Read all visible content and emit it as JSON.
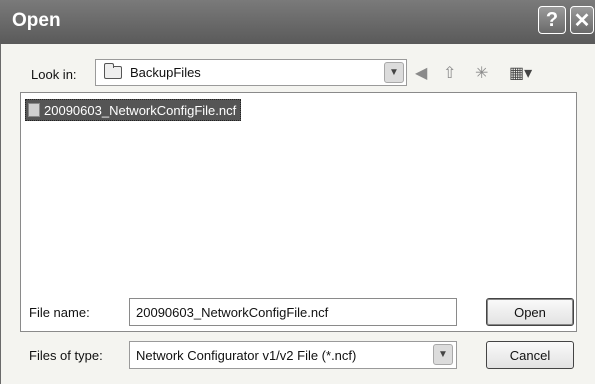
{
  "window": {
    "title": "Open",
    "help_glyph": "?",
    "close_glyph": "✕"
  },
  "lookin": {
    "label": "Look in:",
    "value": "BackupFiles",
    "toolbar_icons": [
      "back-icon",
      "up-folder-icon",
      "new-folder-icon",
      "views-menu-icon"
    ]
  },
  "files": [
    {
      "name": "20090603_NetworkConfigFile.ncf",
      "selected": true
    }
  ],
  "filename": {
    "label": "File name:",
    "value": "20090603_NetworkConfigFile.ncf"
  },
  "filetype": {
    "label": "Files of type:",
    "value": "Network Configurator v1/v2 File (*.ncf)"
  },
  "buttons": {
    "open": "Open",
    "cancel": "Cancel"
  }
}
